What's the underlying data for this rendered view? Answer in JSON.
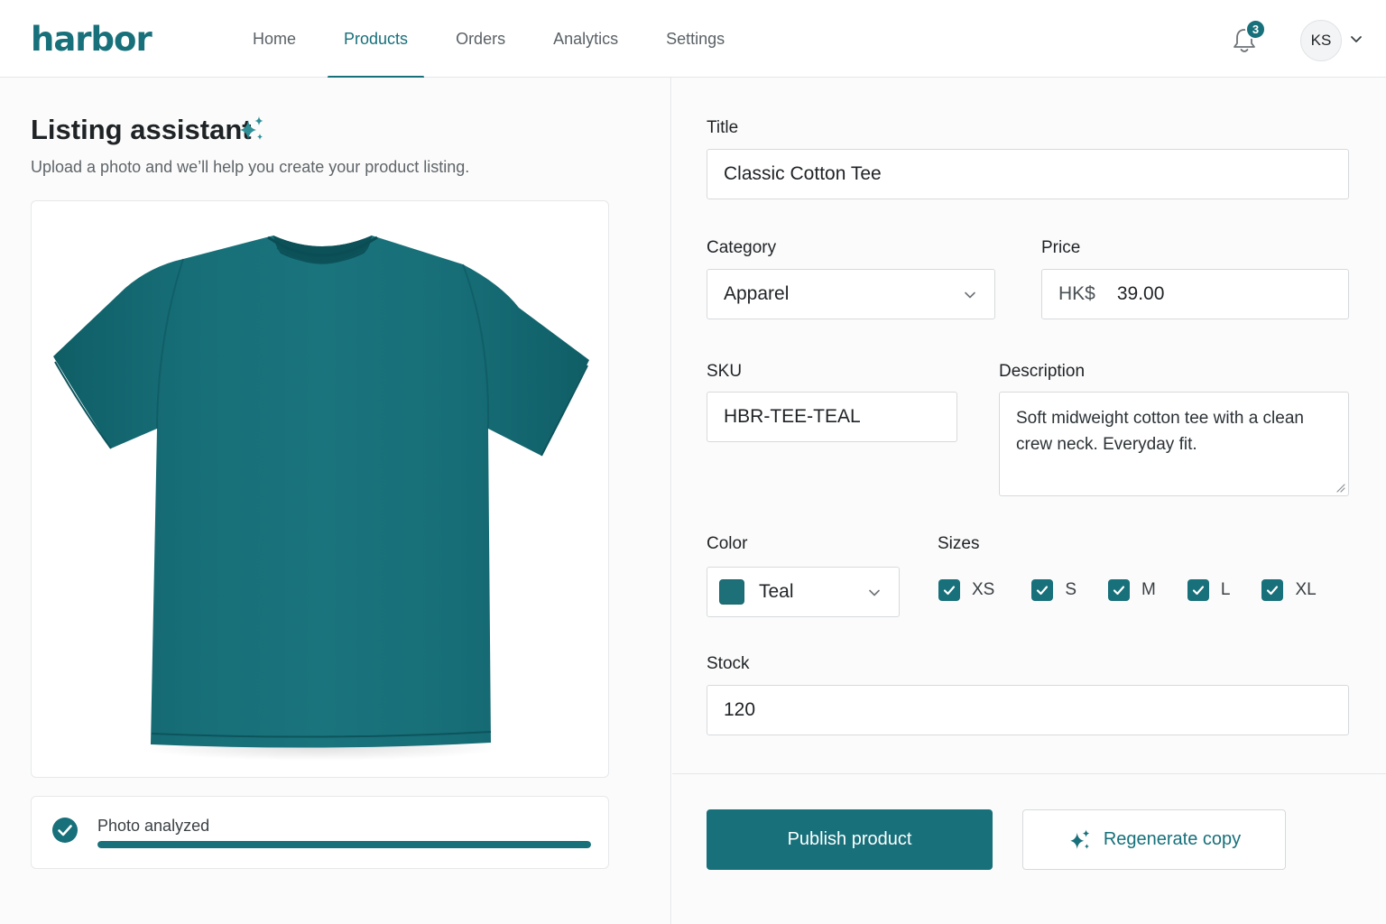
{
  "app": {
    "logo": "harbor",
    "brand_color": "#17707a"
  },
  "nav": {
    "items": [
      "Home",
      "Products",
      "Orders",
      "Analytics",
      "Settings"
    ],
    "active": "Products"
  },
  "header": {
    "notifications_count": "3",
    "user_initials": "KS",
    "icons": [
      "bell-icon",
      "chevron-down-icon"
    ]
  },
  "assistant": {
    "title": "Listing assistant",
    "subtitle": "Upload a photo and we’ll help you create your product listing.",
    "photo_icon": "t-shirt-photo",
    "status_text": "Photo analyzed",
    "progress_percent": 100
  },
  "form": {
    "title_label": "Title",
    "title_value": "Classic Cotton Tee",
    "category_label": "Category",
    "category_value": "Apparel",
    "price_label": "Price",
    "price_currency": "HK$",
    "price_value": "39.00",
    "sku_label": "SKU",
    "sku_value": "HBR-TEE-TEAL",
    "description_label": "Description",
    "description_value": "Soft midweight cotton tee with a clean crew neck. Everyday fit.",
    "color_label": "Color",
    "color_value": "Teal",
    "color_swatch": "#1d6f78",
    "sizes_label": "Sizes",
    "sizes": [
      {
        "label": "XS",
        "checked": true
      },
      {
        "label": "S",
        "checked": true
      },
      {
        "label": "M",
        "checked": true
      },
      {
        "label": "L",
        "checked": true
      },
      {
        "label": "XL",
        "checked": true
      }
    ],
    "stock_label": "Stock",
    "stock_value": "120"
  },
  "actions": {
    "publish_label": "Publish product",
    "regenerate_label": "Regenerate copy"
  }
}
